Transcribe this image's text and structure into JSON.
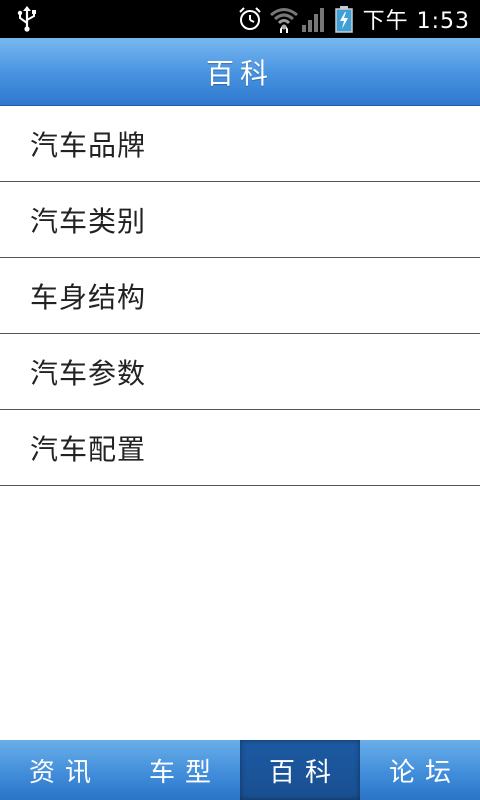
{
  "status_bar": {
    "time": "下午 1:53",
    "icons": [
      "usb-icon",
      "alarm-icon",
      "wifi-icon",
      "signal-icon",
      "battery-charging-icon"
    ]
  },
  "header": {
    "title": "百科"
  },
  "list": {
    "items": [
      {
        "label": "汽车品牌"
      },
      {
        "label": "汽车类别"
      },
      {
        "label": "车身结构"
      },
      {
        "label": "汽车参数"
      },
      {
        "label": "汽车配置"
      }
    ]
  },
  "tabs": {
    "active_index": 2,
    "items": [
      {
        "label": "资讯"
      },
      {
        "label": "车型"
      },
      {
        "label": "百科"
      },
      {
        "label": "论坛"
      }
    ]
  },
  "colors": {
    "header_blue": "#4a95e2",
    "tab_active": "#1c5aa3",
    "status_bar": "#000000"
  }
}
